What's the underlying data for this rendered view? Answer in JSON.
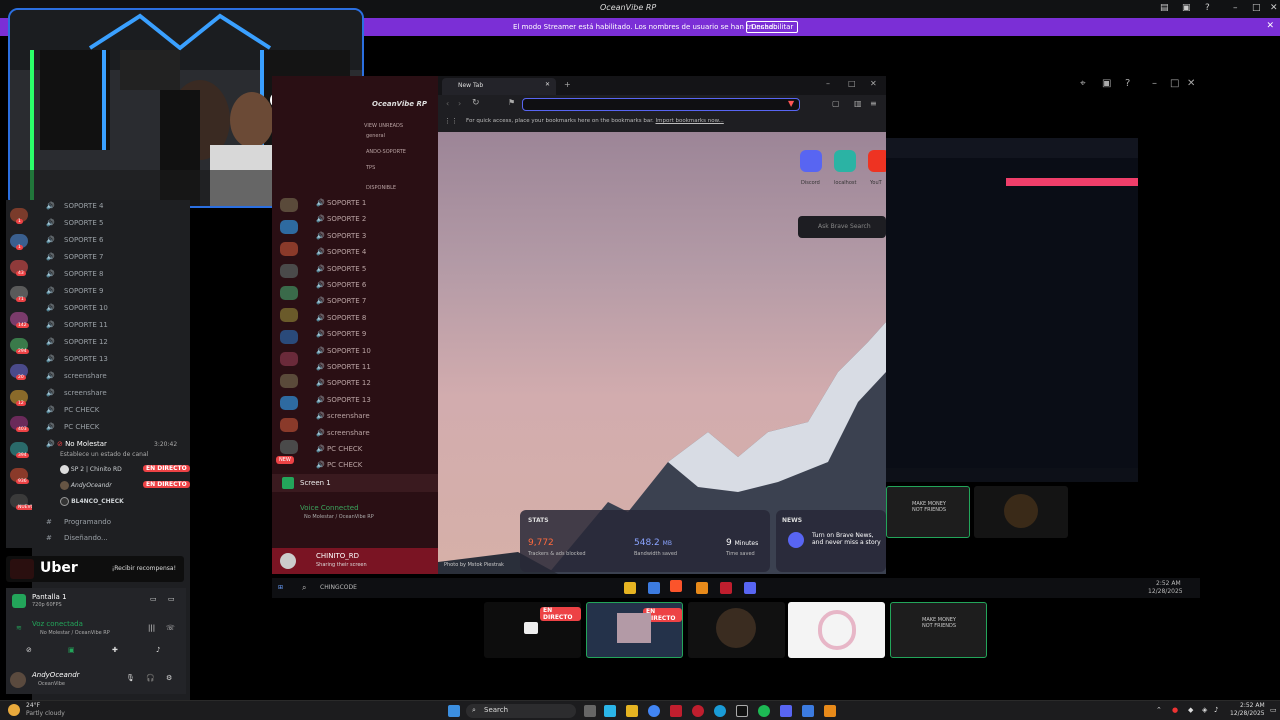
{
  "titlebar": {
    "title": "OceanVibe RP"
  },
  "banner": {
    "message": "El modo Streamer está habilitado. Los nombres de usuario se han truncado.",
    "button": "Deshabilitar"
  },
  "channels_left": [
    "SOPORTE 4",
    "SOPORTE 5",
    "SOPORTE 6",
    "SOPORTE 7",
    "SOPORTE 8",
    "SOPORTE 9",
    "SOPORTE 10",
    "SOPORTE 11",
    "SOPORTE 12",
    "SOPORTE 13",
    "screenshare",
    "screenshare",
    "PC CHECK",
    "PC CHECK"
  ],
  "active_channel": {
    "name": "No Molestar",
    "time": "3:20:42",
    "status_hint": "Establece un estado de canal",
    "members": [
      {
        "name": "SP 2 | Chinito RD",
        "live": "EN DIRECTO"
      },
      {
        "name": "AndyOceandr",
        "live": "EN DIRECTO"
      },
      {
        "name": "BL4NCO_CHECK",
        "live": ""
      }
    ]
  },
  "extra_channels": [
    "Programando",
    "Diseñando..."
  ],
  "guild_badges": [
    "1",
    "1",
    "43",
    "71",
    "142",
    "294",
    "20",
    "12",
    "403",
    "394",
    "936",
    "NUEVO"
  ],
  "uber": {
    "logo": "Uber",
    "cta": "¡Recibir recompensa!"
  },
  "screen_panel": {
    "title": "Pantalla 1",
    "quality": "720p 60FPS"
  },
  "voice": {
    "status": "Voz conectada",
    "detail": "No Molestar / OceanVibe RP"
  },
  "user": {
    "name": "AndyOceandr",
    "server": "OceanVibe"
  },
  "mid_panel": {
    "header": "OceanVibe RP",
    "labels": [
      "VIEW UNREADS",
      "general",
      "ANDO·SOPORTE",
      "TPS",
      "DISPONIBLE"
    ],
    "channels": [
      "SOPORTE 1",
      "SOPORTE 2",
      "SOPORTE 3",
      "SOPORTE 4",
      "SOPORTE 5",
      "SOPORTE 6",
      "SOPORTE 7",
      "SOPORTE 8",
      "SOPORTE 9",
      "SOPORTE 10",
      "SOPORTE 11",
      "SOPORTE 12",
      "SOPORTE 13",
      "screenshare",
      "screenshare",
      "PC CHECK",
      "PC CHECK"
    ],
    "new_badge": "NEW",
    "screen": "Screen 1",
    "voice_connected": "Voice Connected",
    "voice_detail": "No Molestar / OceanVibe RP",
    "user": "CHINITO_RD",
    "user_status": "Sharing their screen"
  },
  "browser": {
    "tab_title": "New Tab",
    "bookmarks_hint": "For quick access, place your bookmarks here on the bookmarks bar.",
    "import_link": "Import bookmarks now...",
    "tiles": [
      {
        "label": "Discord"
      },
      {
        "label": "localhost"
      },
      {
        "label": "YouT"
      }
    ],
    "search_placeholder": "Ask Brave Search",
    "stats": {
      "title": "STATS",
      "trackers": "9,772",
      "trackers_caption": "Trackers & ads blocked",
      "bandwidth": "548.2",
      "bandwidth_unit": "MB",
      "bandwidth_caption": "Bandwidth saved",
      "time": "9",
      "time_unit": "Minutes",
      "time_caption": "Time saved"
    },
    "news": {
      "title": "NEWS",
      "text": "Turn on Brave News, and never miss a story"
    },
    "photo_credit": "Photo by Mstok Piestrak"
  },
  "inner_taskbar": {
    "search": "CHINGCODE",
    "time": "2:52 AM",
    "date": "12/28/2025"
  },
  "thumbnails": [
    {
      "live": "EN DIRECTO"
    },
    {
      "live": "EN DIRECTO"
    },
    {
      "live": ""
    },
    {
      "live": ""
    },
    {
      "live": ""
    }
  ],
  "thumb_text": "MAKE MONEY NOT FRIENDS",
  "taskbar": {
    "weather_temp": "24°F",
    "weather_desc": "Partly cloudy",
    "search": "Search",
    "time": "2:52 AM",
    "date": "12/28/2025"
  }
}
